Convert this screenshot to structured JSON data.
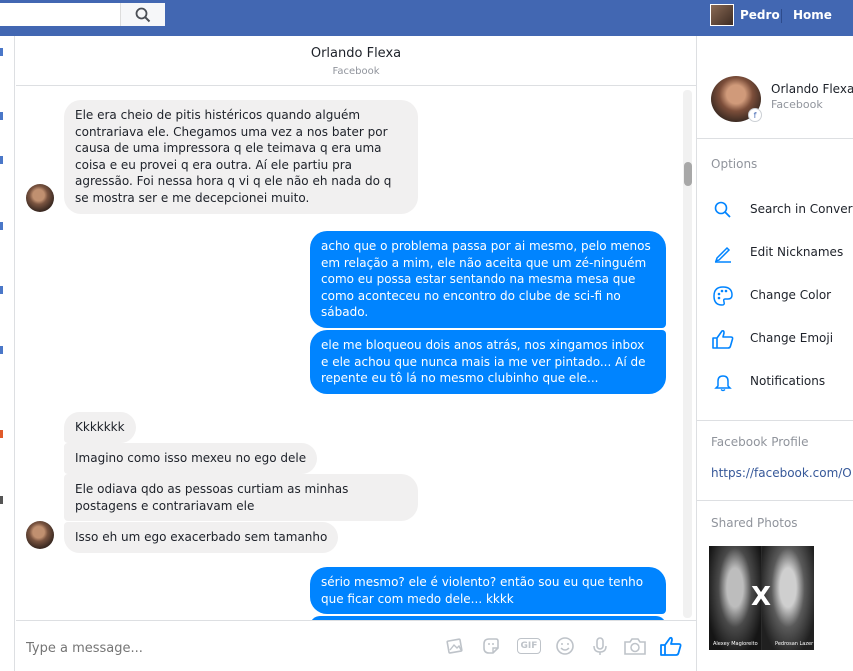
{
  "topbar": {
    "search_placeholder": "",
    "user_name": "Pedro",
    "home_label": "Home",
    "color": "#4267b2"
  },
  "conversation": {
    "name": "Orlando Flexa",
    "source": "Facebook"
  },
  "messages": [
    {
      "direction": "in",
      "text": "Ele era cheio de pitis histéricos quando alguém contrariava ele. Chegamos uma vez a nos bater por causa de uma impressora q ele teimava q era uma coisa e eu provei q era outra. Aí ele partiu pra agressão.  Foi nessa hora q vi q ele não eh nada do q se mostra ser e me decepcionei muito."
    },
    {
      "direction": "out",
      "text": "acho que o problema passa por ai mesmo, pelo menos em relação a mim, ele não aceita que um zé-ninguém como eu possa estar sentando na mesma mesa que como aconteceu no encontro do clube de sci-fi no sábado."
    },
    {
      "direction": "out",
      "text": "ele me bloqueou dois anos atrás, nos xingamos inbox e ele achou que nunca mais ia me ver pintado... Aí de repente eu tô lá no mesmo clubinho que ele..."
    },
    {
      "direction": "in",
      "text": "Kkkkkkk"
    },
    {
      "direction": "in",
      "text": "Imagino como isso mexeu no ego dele"
    },
    {
      "direction": "in",
      "text": "Ele odiava qdo as pessoas curtiam as minhas postagens e contrariavam ele"
    },
    {
      "direction": "in",
      "text": "Isso eh um ego exacerbado sem tamanho"
    },
    {
      "direction": "out",
      "text": "sério mesmo? ele é violento? então sou eu que tenho que ficar com medo dele... kkkk"
    }
  ],
  "composer": {
    "placeholder": "Type a message...",
    "icons": [
      "photo-icon",
      "sticker-icon",
      "gif-icon",
      "emoji-icon",
      "microphone-icon",
      "camera-icon",
      "thumbs-up-icon"
    ],
    "gif_label": "GIF"
  },
  "right_panel": {
    "name": "Orlando Flexa",
    "source": "Facebook",
    "options_heading": "Options",
    "options": [
      {
        "icon": "search-icon",
        "label": "Search in Conversation"
      },
      {
        "icon": "pencil-icon",
        "label": "Edit Nicknames"
      },
      {
        "icon": "palette-icon",
        "label": "Change Color"
      },
      {
        "icon": "thumbs-up-icon",
        "label": "Change Emoji"
      },
      {
        "icon": "bell-icon",
        "label": "Notifications"
      }
    ],
    "profile_heading": "Facebook Profile",
    "profile_link": "https://facebook.com/O",
    "photos_heading": "Shared Photos",
    "photo": {
      "separator": "X",
      "left_caption": "Alexey Magioreito",
      "right_caption": "Pedrosan Lazer"
    }
  },
  "accent_color": "#0084ff"
}
